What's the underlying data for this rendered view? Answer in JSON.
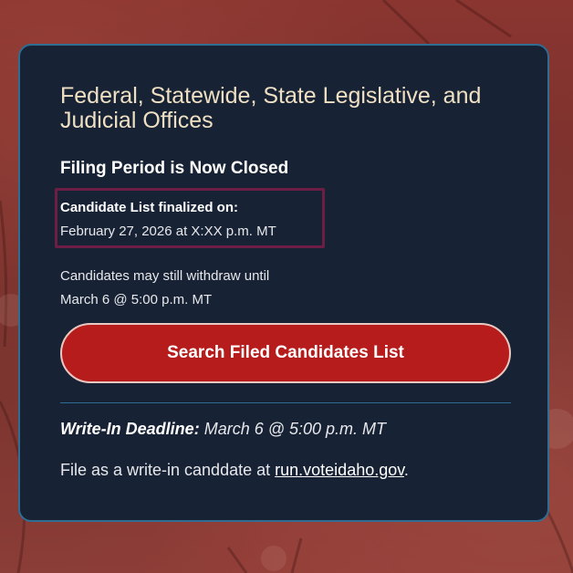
{
  "card": {
    "title": "Federal, Statewide, State Legislative, and Judicial Offices",
    "status": "Filing Period is Now Closed",
    "finalized_label": "Candidate List finalized on:",
    "finalized_date": "February 27, 2026 at X:XX p.m. MT",
    "withdraw_line1": "Candidates may still withdraw until",
    "withdraw_line2": "March 6 @ 5:00 p.m. MT",
    "search_button_label": "Search Filed Candidates List",
    "writein_label": "Write-In Deadline:",
    "writein_value": "March 6 @ 5:00 p.m. MT",
    "fileas_text": "File as a write-in canddate at",
    "fileas_link": "run.voteidaho.gov",
    "fileas_period": "."
  },
  "colors": {
    "card_bg": "#172335",
    "card_border": "#2f6d93",
    "title": "#efe0c4",
    "button_bg": "#b71c1c",
    "highlight_border": "#6c1e45",
    "page_bg": "#7a2a26"
  }
}
